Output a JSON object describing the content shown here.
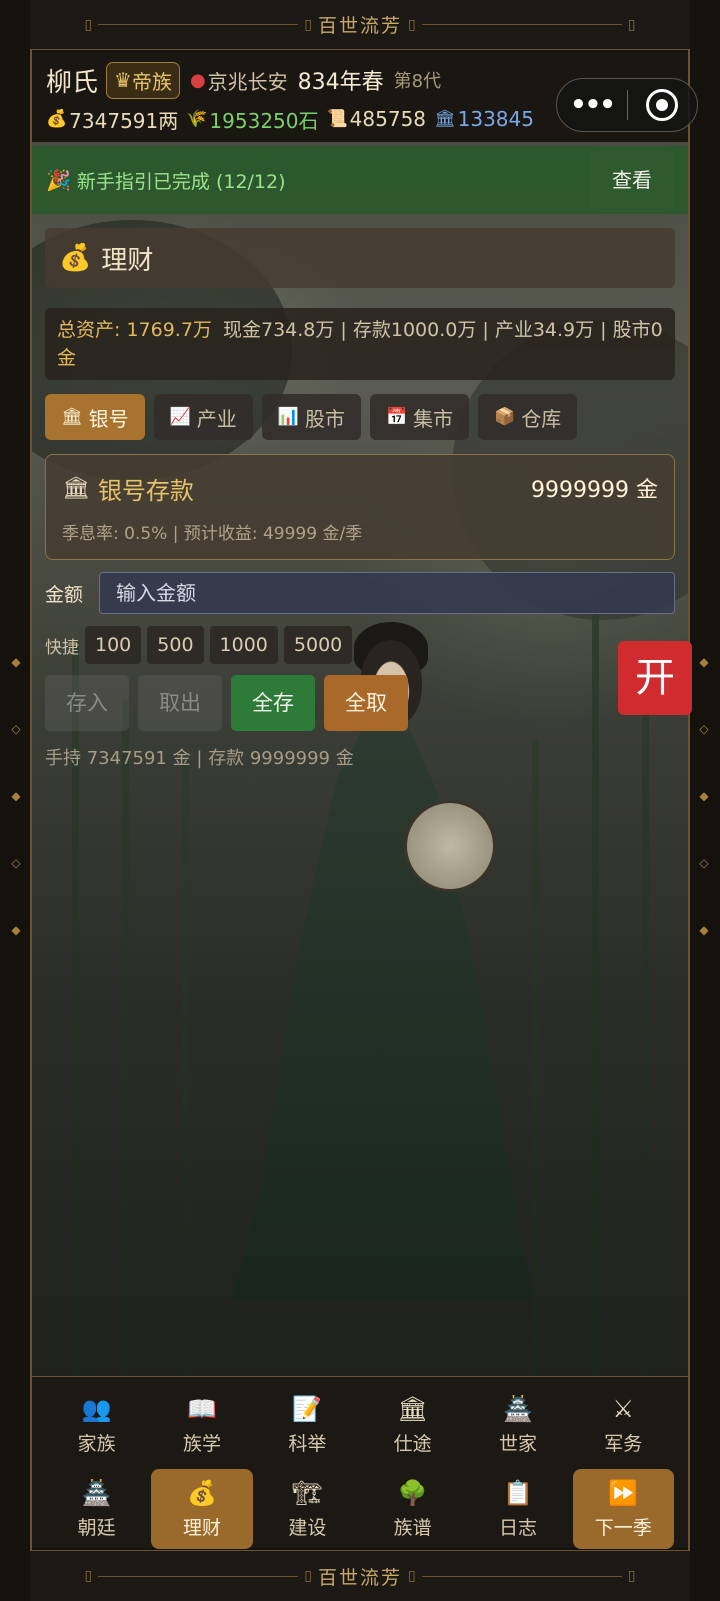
{
  "banner": {
    "title": "百世流芳"
  },
  "header": {
    "clan_name": "柳氏",
    "badge": "帝族",
    "location": "京兆长安",
    "year": "834年春",
    "generation": "第8代",
    "resources": {
      "silver": "7347591两",
      "grain": "1953250石",
      "docs": "485758",
      "prestige": "133845"
    }
  },
  "guide": {
    "text": "新手指引已完成 (12/12)",
    "view_label": "查看"
  },
  "finance": {
    "title": "理财",
    "total_label": "总资产: 1769.7万金",
    "detail": "现金734.8万 | 存款1000.0万 | 产业34.9万 | 股市0"
  },
  "tabs": [
    {
      "label": "银号"
    },
    {
      "label": "产业"
    },
    {
      "label": "股市"
    },
    {
      "label": "集市"
    },
    {
      "label": "仓库"
    }
  ],
  "deposit": {
    "title": "银号存款",
    "amount": "9999999 金",
    "info": "季息率: 0.5% | 预计收益: 49999 金/季"
  },
  "amount_input": {
    "label": "金额",
    "placeholder": "输入金额"
  },
  "quick": {
    "label": "快捷",
    "values": [
      "100",
      "500",
      "1000",
      "5000"
    ]
  },
  "actions": {
    "deposit": "存入",
    "withdraw": "取出",
    "deposit_all": "全存",
    "withdraw_all": "全取"
  },
  "balance": "手持 7347591 金 | 存款 9999999 金",
  "open_button": "开",
  "nav": {
    "row1": [
      "家族",
      "族学",
      "科举",
      "仕途",
      "世家",
      "军务"
    ],
    "row2": [
      "朝廷",
      "理财",
      "建设",
      "族谱",
      "日志",
      "下一季"
    ]
  },
  "colors": {
    "accent_gold": "#e6c36a",
    "active_tab": "#a8732e",
    "open_red": "#d02c30",
    "grain_green": "#7ad06a",
    "prestige_blue": "#7aa8e6"
  },
  "icons": {
    "silver": "money-bag-icon",
    "grain": "grain-icon",
    "docs": "scroll-icon",
    "prestige": "bank-icon",
    "capsule_more": "more-icon",
    "capsule_close": "target-icon"
  }
}
